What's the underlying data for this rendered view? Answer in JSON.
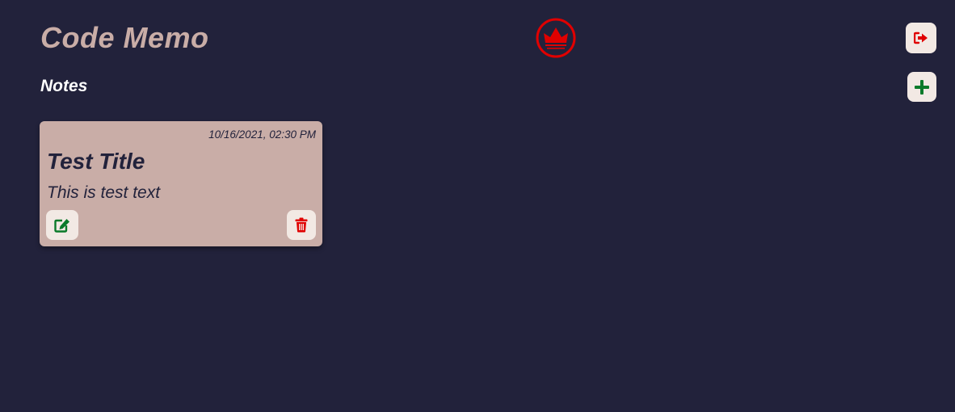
{
  "header": {
    "app_title": "Code Memo",
    "logo_icon": "crown-icon",
    "logout_icon": "sign-out-icon"
  },
  "notes_section": {
    "title": "Notes",
    "add_icon": "plus-icon"
  },
  "notes": [
    {
      "date": "10/16/2021, 02:30 PM",
      "title": "Test Title",
      "text": "This is test text",
      "edit_icon": "edit-icon",
      "delete_icon": "trash-icon"
    }
  ],
  "colors": {
    "background": "#22223b",
    "card": "#c9ada7",
    "button": "#f2e9e4",
    "accent_red": "#e00000",
    "accent_green": "#0a7a2a",
    "title": "#c9ada7"
  }
}
